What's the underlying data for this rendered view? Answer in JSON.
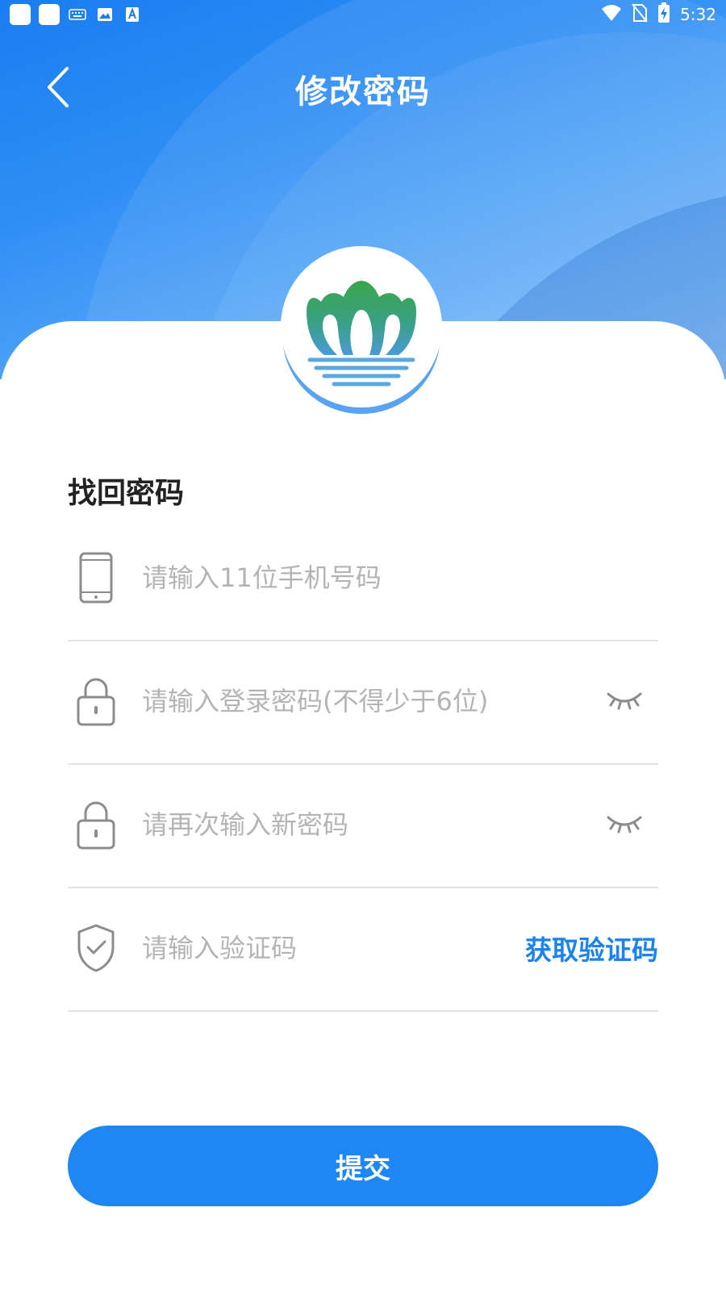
{
  "status_bar": {
    "time": "5:32",
    "left_icons": [
      "app-square",
      "app-square",
      "keyboard-icon",
      "image-icon",
      "text-icon"
    ],
    "right_icons": [
      "wifi-icon",
      "no-sim-icon",
      "battery-charging-icon"
    ]
  },
  "navbar": {
    "title": "修改密码",
    "back_icon": "chevron-left-icon"
  },
  "logo": {
    "name": "app-logo"
  },
  "form": {
    "section_title": "找回密码",
    "phone": {
      "placeholder": "请输入11位手机号码",
      "icon": "phone-icon"
    },
    "password": {
      "placeholder": "请输入登录密码(不得少于6位)",
      "icon": "lock-icon",
      "toggle_icon": "eye-closed-icon"
    },
    "confirm_password": {
      "placeholder": "请再次输入新密码",
      "icon": "lock-icon",
      "toggle_icon": "eye-closed-icon"
    },
    "code": {
      "placeholder": "请输入验证码",
      "icon": "shield-check-icon",
      "get_code_label": "获取验证码"
    }
  },
  "submit_label": "提交",
  "colors": {
    "primary": "#1f87f3",
    "link": "#1b82ee",
    "placeholder": "#b4b4b4",
    "divider": "#e3e3e3",
    "title": "#222222"
  }
}
